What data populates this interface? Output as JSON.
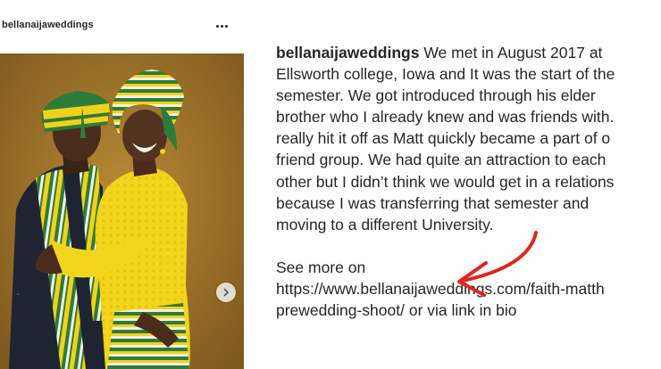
{
  "post": {
    "username": "bellanaijaweddings",
    "more_icon": "more-horizontal-icon"
  },
  "media": {
    "next_icon": "chevron-right-icon",
    "accent_colors": {
      "background": "#a77a2b",
      "yellow": "#f1d21a",
      "green": "#2d7b3a",
      "red": "#d83228"
    }
  },
  "caption": {
    "username": "bellanaijaweddings",
    "first_line_text": "We met in August 2017 at",
    "lines": [
      "Ellsworth college, Iowa and It was the start of the",
      "semester. We got introduced through his elder",
      "brother who I already knew and was friends with.",
      "really hit it off as Matt quickly became a part of o",
      "friend group. We had quite an attraction to each",
      "other but I didn’t think we would get in a relations",
      "because I was transferring that semester and",
      "moving to a different University."
    ],
    "see_more_lines": [
      "See more on",
      "https://www.bellanaijaweddings.com/faith-matth",
      "prewedding-shoot/ or via link in bio"
    ]
  },
  "annotation": {
    "arrow_color": "#e0251b"
  }
}
